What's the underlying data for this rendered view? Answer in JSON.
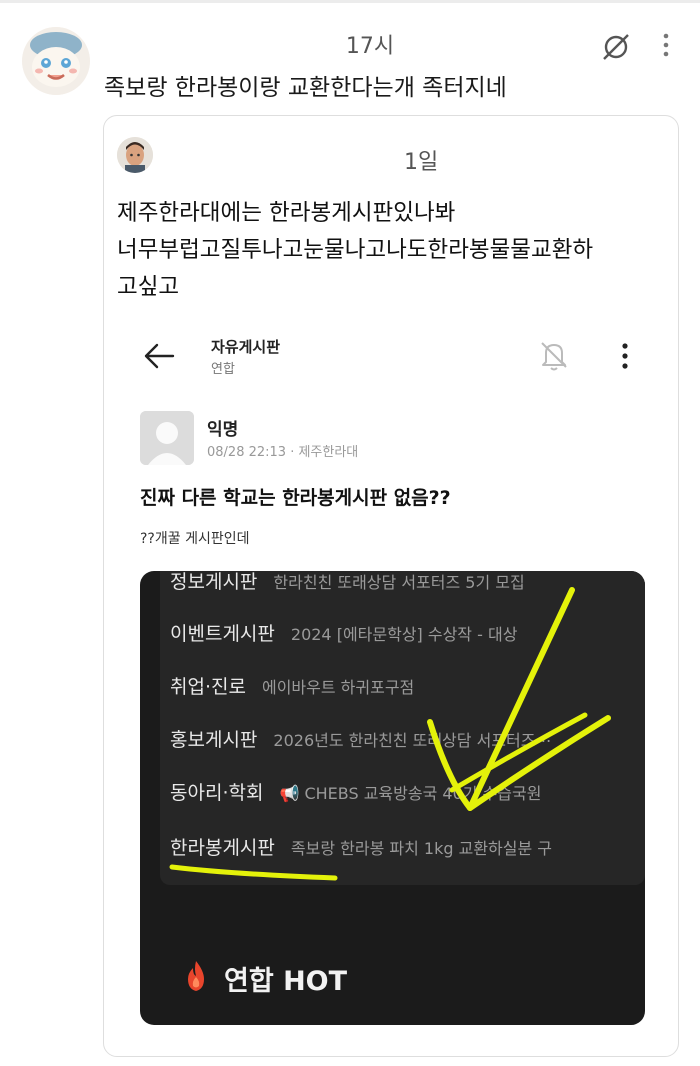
{
  "main_post": {
    "time": "17시",
    "text": "족보랑 한라봉이랑 교환한다는개 족터지네"
  },
  "quoted_post": {
    "time": "1일",
    "lines": [
      "제주한라대에는 한라봉게시판있나봐",
      "너무부럽고질투나고눈물나고나도한라봉물물교환하",
      "고싶고"
    ]
  },
  "embedded_screenshot": {
    "board_title": "자유게시판",
    "board_sub": "연합",
    "author": "익명",
    "meta": "08/28 22:13 · 제주한라대",
    "post_title": "진짜 다른 학교는 한라봉게시판 없음??",
    "post_body": "??개꿀 게시판인데",
    "boards": [
      {
        "name": "정보게시판",
        "preview": "한라친친 또래상담 서포터즈 5기 모집"
      },
      {
        "name": "이벤트게시판",
        "preview": "2024 [에타문학상] 수상작 - 대상"
      },
      {
        "name": "취업·진로",
        "preview": "에이바우트 하귀포구점"
      },
      {
        "name": "홍보게시판",
        "preview": "2026년도 한라친친 또래상담 서포터즈⋯"
      },
      {
        "name": "동아리·학회",
        "preview": "📢 CHEBS 교육방송국 40기 수습국원"
      },
      {
        "name": "한라봉게시판",
        "preview": "족보랑 한라봉 파치 1kg 교환하실분 구"
      }
    ],
    "hot_label": "연합 HOT"
  },
  "colors": {
    "highlighter": "#e4f20a",
    "dark_bg": "#1b1b1b",
    "flame": "#e8452c"
  },
  "icons": [
    "hidden-icon",
    "more-vertical-icon",
    "back-arrow-icon",
    "bell-off-icon",
    "flame-icon"
  ]
}
